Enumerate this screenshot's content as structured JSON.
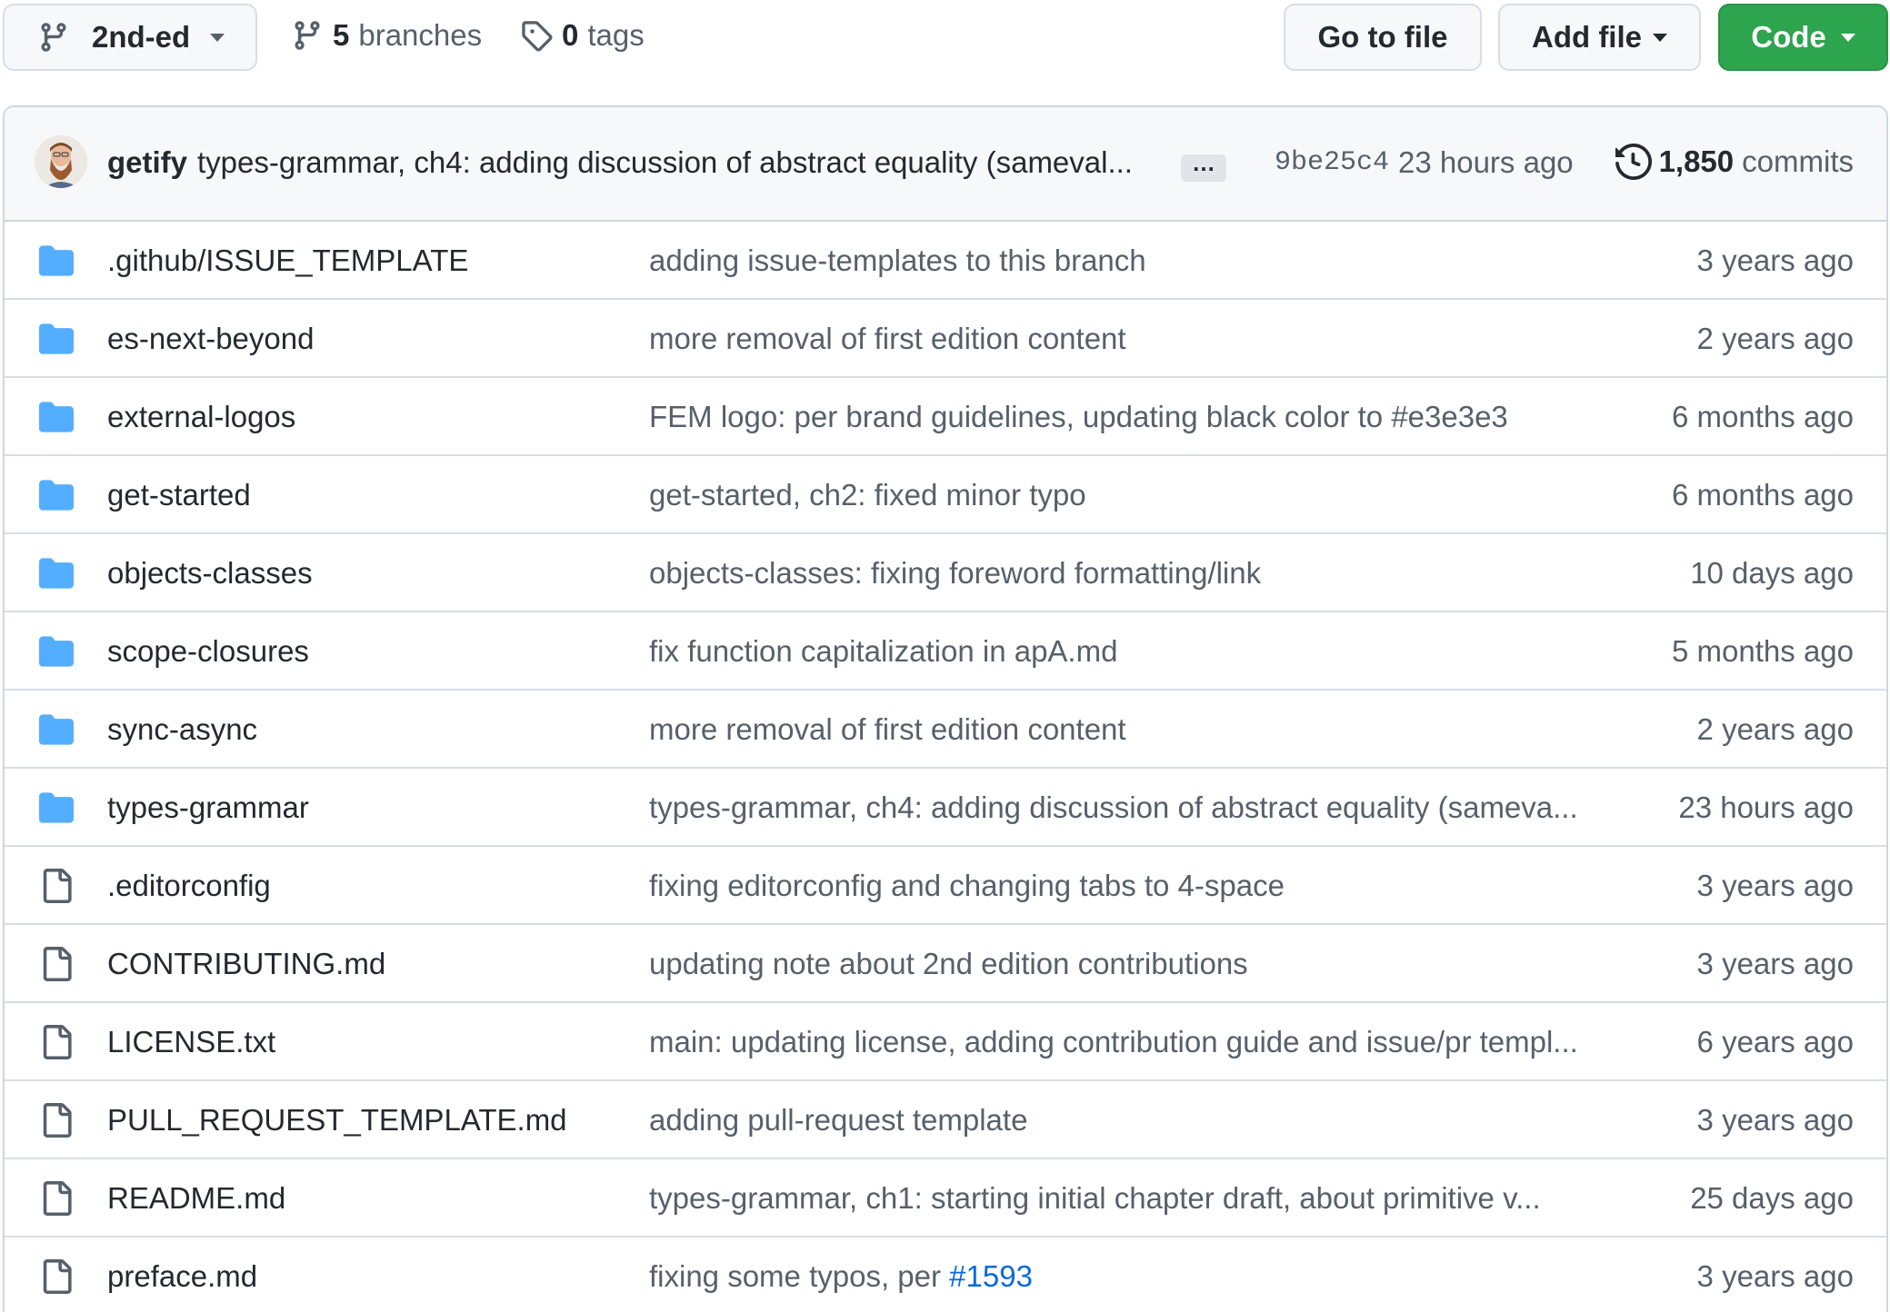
{
  "toolbar": {
    "branch": "2nd-ed",
    "branches_count": "5",
    "branches_label": "branches",
    "tags_count": "0",
    "tags_label": "tags",
    "goto_file": "Go to file",
    "add_file": "Add file",
    "code": "Code",
    "code_color": "#2da44e"
  },
  "latest_commit": {
    "author": "getify",
    "message": "types-grammar, ch4: adding discussion of abstract equality (sameval...",
    "ellipsis": "…",
    "sha": "9be25c4",
    "time": "23 hours ago",
    "commits_count": "1,850",
    "commits_label": "commits"
  },
  "files": [
    {
      "type": "folder",
      "icon": "folder-icon",
      "name": ".github/ISSUE_TEMPLATE",
      "message": "adding issue-templates to this branch",
      "time": "3 years ago"
    },
    {
      "type": "folder",
      "icon": "folder-icon",
      "name": "es-next-beyond",
      "message": "more removal of first edition content",
      "time": "2 years ago"
    },
    {
      "type": "folder",
      "icon": "folder-icon",
      "name": "external-logos",
      "message": "FEM logo: per brand guidelines, updating black color to #e3e3e3",
      "time": "6 months ago"
    },
    {
      "type": "folder",
      "icon": "folder-icon",
      "name": "get-started",
      "message": "get-started, ch2: fixed minor typo",
      "time": "6 months ago"
    },
    {
      "type": "folder",
      "icon": "folder-icon",
      "name": "objects-classes",
      "message": "objects-classes: fixing foreword formatting/link",
      "time": "10 days ago"
    },
    {
      "type": "folder",
      "icon": "folder-icon",
      "name": "scope-closures",
      "message": "fix function capitalization in apA.md",
      "time": "5 months ago"
    },
    {
      "type": "folder",
      "icon": "folder-icon",
      "name": "sync-async",
      "message": "more removal of first edition content",
      "time": "2 years ago"
    },
    {
      "type": "folder",
      "icon": "folder-icon",
      "name": "types-grammar",
      "message": "types-grammar, ch4: adding discussion of abstract equality (sameva...",
      "time": "23 hours ago"
    },
    {
      "type": "file",
      "icon": "file-icon",
      "name": ".editorconfig",
      "message": "fixing editorconfig and changing tabs to 4-space",
      "time": "3 years ago"
    },
    {
      "type": "file",
      "icon": "file-icon",
      "name": "CONTRIBUTING.md",
      "message": "updating note about 2nd edition contributions",
      "time": "3 years ago"
    },
    {
      "type": "file",
      "icon": "file-icon",
      "name": "LICENSE.txt",
      "message": "main: updating license, adding contribution guide and issue/pr templ...",
      "time": "6 years ago"
    },
    {
      "type": "file",
      "icon": "file-icon",
      "name": "PULL_REQUEST_TEMPLATE.md",
      "message": "adding pull-request template",
      "time": "3 years ago"
    },
    {
      "type": "file",
      "icon": "file-icon",
      "name": "README.md",
      "message": "types-grammar, ch1: starting initial chapter draft, about primitive v...",
      "time": "25 days ago"
    },
    {
      "type": "file",
      "icon": "file-icon",
      "name": "preface.md",
      "message": "fixing some typos, per ",
      "message_link": "#1593",
      "time": "3 years ago"
    }
  ],
  "colors": {
    "folder": "#54aeff",
    "link": "#0969da",
    "muted": "#57606a",
    "border": "#d0d7de"
  }
}
